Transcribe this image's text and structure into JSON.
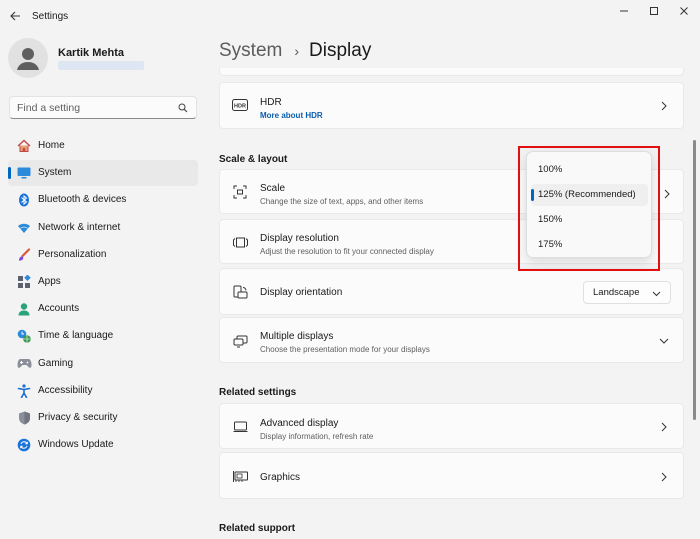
{
  "window": {
    "app_title": "Settings",
    "minimize": "–",
    "maximize": "□",
    "close": "✕"
  },
  "profile": {
    "name": "Kartik Mehta"
  },
  "search": {
    "placeholder": "Find a setting"
  },
  "nav": [
    {
      "label": "Home",
      "icon": "home-icon",
      "active": false
    },
    {
      "label": "System",
      "icon": "system-icon",
      "active": true
    },
    {
      "label": "Bluetooth & devices",
      "icon": "bluetooth-icon",
      "active": false
    },
    {
      "label": "Network & internet",
      "icon": "network-icon",
      "active": false
    },
    {
      "label": "Personalization",
      "icon": "brush-icon",
      "active": false
    },
    {
      "label": "Apps",
      "icon": "apps-icon",
      "active": false
    },
    {
      "label": "Accounts",
      "icon": "accounts-icon",
      "active": false
    },
    {
      "label": "Time & language",
      "icon": "time-language-icon",
      "active": false
    },
    {
      "label": "Gaming",
      "icon": "gaming-icon",
      "active": false
    },
    {
      "label": "Accessibility",
      "icon": "accessibility-icon",
      "active": false
    },
    {
      "label": "Privacy & security",
      "icon": "shield-icon",
      "active": false
    },
    {
      "label": "Windows Update",
      "icon": "update-icon",
      "active": false
    }
  ],
  "breadcrumb": {
    "parent": "System",
    "separator": "›",
    "current": "Display"
  },
  "hdr": {
    "title": "HDR",
    "link": "More about HDR"
  },
  "scale_layout": {
    "heading": "Scale & layout",
    "scale": {
      "title": "Scale",
      "subtitle": "Change the size of text, apps, and other items"
    },
    "resolution": {
      "title": "Display resolution",
      "subtitle": "Adjust the resolution to fit your connected display"
    },
    "orientation": {
      "title": "Display orientation",
      "value": "Landscape"
    },
    "multiple": {
      "title": "Multiple displays",
      "subtitle": "Choose the presentation mode for your displays"
    }
  },
  "related_settings": {
    "heading": "Related settings",
    "advanced": {
      "title": "Advanced display",
      "subtitle": "Display information, refresh rate"
    },
    "graphics": {
      "title": "Graphics"
    }
  },
  "related_support": {
    "heading": "Related support"
  },
  "scale_flyout": {
    "options": [
      "100%",
      "125% (Recommended)",
      "150%",
      "175%"
    ],
    "selected": "125% (Recommended)"
  },
  "colors": {
    "accent": "#0067c0",
    "highlight": "#e01010"
  }
}
